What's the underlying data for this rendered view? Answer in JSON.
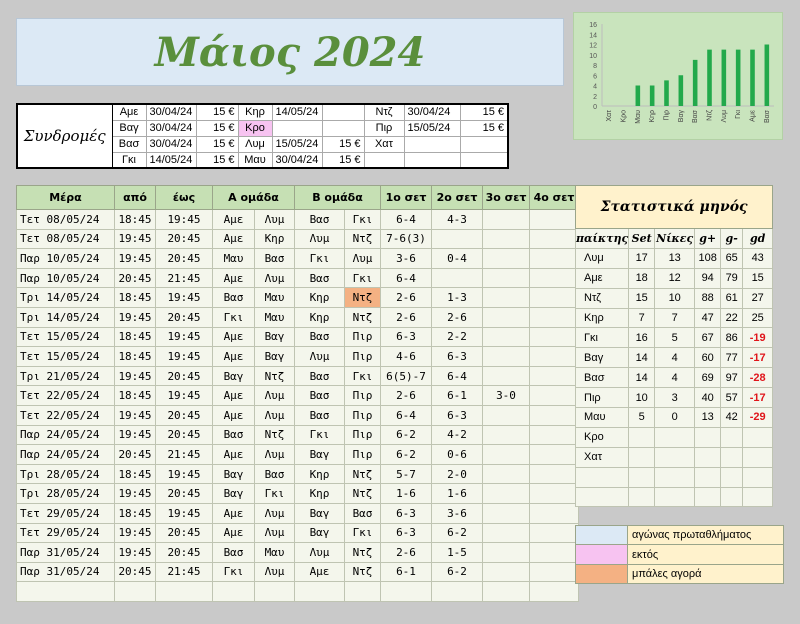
{
  "title": "Μάιος 2024",
  "colors": {
    "title_green": "#5a8f3c",
    "header_green": "#c6e0b4",
    "title_bg": "#dce9f5",
    "chart_bg": "#c9e4bd",
    "bar_green": "#22a94b",
    "pink": "#f7c3f1",
    "orange": "#f4b183",
    "negative": "#e0151b",
    "stats_title_bg": "#fff2cc"
  },
  "subscriptions": {
    "label": "Συνδρομές",
    "rows": [
      [
        {
          "code": "Αμε",
          "date": "30/04/24",
          "amount": "15 €"
        },
        {
          "code": "Κηρ",
          "date": "14/05/24",
          "amount": ""
        },
        {
          "code": "Ντζ",
          "date": "30/04/24",
          "amount": "15 €"
        }
      ],
      [
        {
          "code": "Βαγ",
          "date": "30/04/24",
          "amount": "15 €"
        },
        {
          "code": "Κρο",
          "date": "",
          "amount": "",
          "pink": true
        },
        {
          "code": "Πιρ",
          "date": "15/05/24",
          "amount": "15 €"
        }
      ],
      [
        {
          "code": "Βασ",
          "date": "30/04/24",
          "amount": "15 €"
        },
        {
          "code": "Λυμ",
          "date": "15/05/24",
          "amount": "15 €"
        },
        {
          "code": "Χατ",
          "date": "",
          "amount": ""
        }
      ],
      [
        {
          "code": "Γκι",
          "date": "14/05/24",
          "amount": "15 €"
        },
        {
          "code": "Μαυ",
          "date": "30/04/24",
          "amount": "15 €"
        },
        {
          "code": "",
          "date": "",
          "amount": ""
        }
      ]
    ]
  },
  "matches": {
    "headers": [
      "Μέρα",
      "από",
      "έως",
      "Α ομάδα",
      "",
      "Β ομάδα",
      "",
      "1ο σετ",
      "2ο σετ",
      "3ο σετ",
      "4ο σετ"
    ],
    "rows": [
      {
        "day": "Τετ 08/05/24",
        "from": "18:45",
        "to": "19:45",
        "a1": "Αμε",
        "a2": "Λυμ",
        "b1": "Βασ",
        "b2": "Γκι",
        "s1": "6-4",
        "s2": "4-3",
        "s3": "",
        "s4": ""
      },
      {
        "day": "Τετ 08/05/24",
        "from": "19:45",
        "to": "20:45",
        "a1": "Αμε",
        "a2": "Κηρ",
        "b1": "Λυμ",
        "b2": "Ντζ",
        "s1": "7-6(3)",
        "s2": "",
        "s3": "",
        "s4": ""
      },
      {
        "day": "Παρ 10/05/24",
        "from": "19:45",
        "to": "20:45",
        "a1": "Μαυ",
        "a2": "Βασ",
        "b1": "Γκι",
        "b2": "Λυμ",
        "s1": "3-6",
        "s2": "0-4",
        "s3": "",
        "s4": ""
      },
      {
        "day": "Παρ 10/05/24",
        "from": "20:45",
        "to": "21:45",
        "a1": "Αμε",
        "a2": "Λυμ",
        "b1": "Βασ",
        "b2": "Γκι",
        "s1": "6-4",
        "s2": "",
        "s3": "",
        "s4": ""
      },
      {
        "day": "Τρι 14/05/24",
        "from": "18:45",
        "to": "19:45",
        "a1": "Βασ",
        "a2": "Μαυ",
        "b1": "Κηρ",
        "b2": "Ντζ",
        "b2_orange": true,
        "s1": "2-6",
        "s2": "1-3",
        "s3": "",
        "s4": ""
      },
      {
        "day": "Τρι 14/05/24",
        "from": "19:45",
        "to": "20:45",
        "a1": "Γκι",
        "a2": "Μαυ",
        "b1": "Κηρ",
        "b2": "Ντζ",
        "s1": "2-6",
        "s2": "2-6",
        "s3": "",
        "s4": ""
      },
      {
        "day": "Τετ 15/05/24",
        "from": "18:45",
        "to": "19:45",
        "a1": "Αμε",
        "a2": "Βαγ",
        "b1": "Βασ",
        "b2": "Πιρ",
        "s1": "6-3",
        "s2": "2-2",
        "s3": "",
        "s4": ""
      },
      {
        "day": "Τετ 15/05/24",
        "from": "18:45",
        "to": "19:45",
        "a1": "Αμε",
        "a2": "Βαγ",
        "b1": "Λυμ",
        "b2": "Πιρ",
        "s1": "4-6",
        "s2": "6-3",
        "s3": "",
        "s4": ""
      },
      {
        "day": "Τρι 21/05/24",
        "from": "19:45",
        "to": "20:45",
        "a1": "Βαγ",
        "a2": "Ντζ",
        "b1": "Βασ",
        "b2": "Γκι",
        "s1": "6(5)-7",
        "s2": "6-4",
        "s3": "",
        "s4": ""
      },
      {
        "day": "Τετ 22/05/24",
        "from": "18:45",
        "to": "19:45",
        "a1": "Αμε",
        "a2": "Λυμ",
        "b1": "Βασ",
        "b2": "Πιρ",
        "s1": "2-6",
        "s2": "6-1",
        "s3": "3-0",
        "s4": ""
      },
      {
        "day": "Τετ 22/05/24",
        "from": "19:45",
        "to": "20:45",
        "a1": "Αμε",
        "a2": "Λυμ",
        "b1": "Βασ",
        "b2": "Πιρ",
        "s1": "6-4",
        "s2": "6-3",
        "s3": "",
        "s4": ""
      },
      {
        "day": "Παρ 24/05/24",
        "from": "19:45",
        "to": "20:45",
        "a1": "Βασ",
        "a2": "Ντζ",
        "b1": "Γκι",
        "b2": "Πιρ",
        "s1": "6-2",
        "s2": "4-2",
        "s3": "",
        "s4": ""
      },
      {
        "day": "Παρ 24/05/24",
        "from": "20:45",
        "to": "21:45",
        "a1": "Αμε",
        "a2": "Λυμ",
        "b1": "Βαγ",
        "b2": "Πιρ",
        "s1": "6-2",
        "s2": "0-6",
        "s3": "",
        "s4": ""
      },
      {
        "day": "Τρι 28/05/24",
        "from": "18:45",
        "to": "19:45",
        "a1": "Βαγ",
        "a2": "Βασ",
        "b1": "Κηρ",
        "b2": "Ντζ",
        "s1": "5-7",
        "s2": "2-0",
        "s3": "",
        "s4": ""
      },
      {
        "day": "Τρι 28/05/24",
        "from": "19:45",
        "to": "20:45",
        "a1": "Βαγ",
        "a2": "Γκι",
        "b1": "Κηρ",
        "b2": "Ντζ",
        "s1": "1-6",
        "s2": "1-6",
        "s3": "",
        "s4": ""
      },
      {
        "day": "Τετ 29/05/24",
        "from": "18:45",
        "to": "19:45",
        "a1": "Αμε",
        "a2": "Λυμ",
        "b1": "Βαγ",
        "b2": "Βασ",
        "s1": "6-3",
        "s2": "3-6",
        "s3": "",
        "s4": ""
      },
      {
        "day": "Τετ 29/05/24",
        "from": "19:45",
        "to": "20:45",
        "a1": "Αμε",
        "a2": "Λυμ",
        "b1": "Βαγ",
        "b2": "Γκι",
        "s1": "6-3",
        "s2": "6-2",
        "s3": "",
        "s4": ""
      },
      {
        "day": "Παρ 31/05/24",
        "from": "19:45",
        "to": "20:45",
        "a1": "Βασ",
        "a2": "Μαυ",
        "b1": "Λυμ",
        "b2": "Ντζ",
        "s1": "2-6",
        "s2": "1-5",
        "s3": "",
        "s4": ""
      },
      {
        "day": "Παρ 31/05/24",
        "from": "20:45",
        "to": "21:45",
        "a1": "Γκι",
        "a2": "Λυμ",
        "b1": "Αμε",
        "b2": "Ντζ",
        "s1": "6-1",
        "s2": "6-2",
        "s3": "",
        "s4": ""
      },
      {
        "day": "",
        "from": "",
        "to": "",
        "a1": "",
        "a2": "",
        "b1": "",
        "b2": "",
        "s1": "",
        "s2": "",
        "s3": "",
        "s4": ""
      }
    ]
  },
  "stats": {
    "title": "Στατιστικά μηνός",
    "headers": [
      "παίκτης",
      "Set",
      "Νίκες",
      "g+",
      "g-",
      "gd"
    ],
    "rows": [
      {
        "name": "Λυμ",
        "set": "17",
        "wins": "13",
        "gp": "108",
        "gm": "65",
        "gd": "43",
        "neg": false
      },
      {
        "name": "Αμε",
        "set": "18",
        "wins": "12",
        "gp": "94",
        "gm": "79",
        "gd": "15",
        "neg": false
      },
      {
        "name": "Ντζ",
        "set": "15",
        "wins": "10",
        "gp": "88",
        "gm": "61",
        "gd": "27",
        "neg": false
      },
      {
        "name": "Κηρ",
        "set": "7",
        "wins": "7",
        "gp": "47",
        "gm": "22",
        "gd": "25",
        "neg": false
      },
      {
        "name": "Γκι",
        "set": "16",
        "wins": "5",
        "gp": "67",
        "gm": "86",
        "gd": "-19",
        "neg": true
      },
      {
        "name": "Βαγ",
        "set": "14",
        "wins": "4",
        "gp": "60",
        "gm": "77",
        "gd": "-17",
        "neg": true
      },
      {
        "name": "Βασ",
        "set": "14",
        "wins": "4",
        "gp": "69",
        "gm": "97",
        "gd": "-28",
        "neg": true
      },
      {
        "name": "Πιρ",
        "set": "10",
        "wins": "3",
        "gp": "40",
        "gm": "57",
        "gd": "-17",
        "neg": true
      },
      {
        "name": "Μαυ",
        "set": "5",
        "wins": "0",
        "gp": "13",
        "gm": "42",
        "gd": "-29",
        "neg": true
      },
      {
        "name": "Κρο",
        "set": "",
        "wins": "",
        "gp": "",
        "gm": "",
        "gd": "",
        "neg": false
      },
      {
        "name": "Χατ",
        "set": "",
        "wins": "",
        "gp": "",
        "gm": "",
        "gd": "",
        "neg": false
      },
      {
        "name": "",
        "set": "",
        "wins": "",
        "gp": "",
        "gm": "",
        "gd": "",
        "neg": false
      },
      {
        "name": "",
        "set": "",
        "wins": "",
        "gp": "",
        "gm": "",
        "gd": "",
        "neg": false
      }
    ]
  },
  "legend": [
    {
      "color": "#dce9f5",
      "text": "αγώνας πρωταθλήματος"
    },
    {
      "color": "#f7c3f1",
      "text": "εκτός"
    },
    {
      "color": "#f4b183",
      "text": "μπάλες αγορά"
    }
  ],
  "chart_data": {
    "type": "bar",
    "categories": [
      "Χατ",
      "Κρο",
      "Μαυ",
      "Κηρ",
      "Πιρ",
      "Βαγ",
      "Βασ",
      "Ντζ",
      "Λυμ",
      "Γκι",
      "Αμε",
      "Βασ"
    ],
    "values": [
      0,
      0,
      4,
      4,
      5,
      6,
      9,
      11,
      11,
      11,
      11,
      12
    ],
    "ylim": [
      0,
      16
    ],
    "yticks": [
      0,
      2,
      4,
      6,
      8,
      10,
      12,
      14,
      16
    ],
    "grid": false,
    "legend": "none",
    "bar_color": "#22a94b"
  }
}
